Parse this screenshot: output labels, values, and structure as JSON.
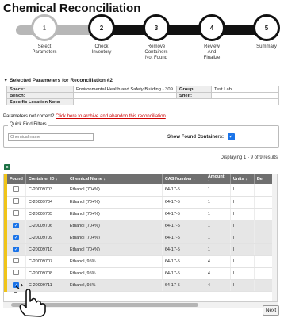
{
  "page_title": "Chemical Reconciliation",
  "steps": [
    {
      "num": "1",
      "label": "Select\nParameters"
    },
    {
      "num": "2",
      "label": "Check\nInventory"
    },
    {
      "num": "3",
      "label": "Remove\nContainers\nNot Found"
    },
    {
      "num": "4",
      "label": "Review\nAnd\nFinalize"
    },
    {
      "num": "5",
      "label": "Summary"
    }
  ],
  "selected_params_heading": "▼ Selected Parameters for Reconciliation #2",
  "params": {
    "space_label": "Space:",
    "space_value": "Environmental Health and Safety Building - 309",
    "group_label": "Group:",
    "group_value": "Test Lab",
    "bench_label": "Bench:",
    "bench_value": "",
    "shelf_label": "Shelf:",
    "shelf_value": "",
    "note_label": "Specific Location Note:",
    "note_value": ""
  },
  "not_correct_text": "Parameters not correct? ",
  "archive_link": "Click here to archive and abandon this reconciliation",
  "quick_find": {
    "legend": "Quick Find Filters",
    "chemical_placeholder": "Chemical name",
    "show_found_label": "Show Found Containers:",
    "show_found_checked": true
  },
  "displaying": "Displaying 1 - 9 of 9 results",
  "grid": {
    "headers": [
      "Found",
      "Container ID ↕",
      "Chemical Name ↕",
      "CAS Number ↕",
      "Amount ↕",
      "Units ↕",
      "Be"
    ],
    "rows": [
      {
        "found": false,
        "id": "C-20009703",
        "name": "Ethanol (70+%)",
        "cas": "64-17-5",
        "amount": "1",
        "units": "l"
      },
      {
        "found": false,
        "id": "C-20009704",
        "name": "Ethanol (70+%)",
        "cas": "64-17-5",
        "amount": "1",
        "units": "l"
      },
      {
        "found": false,
        "id": "C-20009705",
        "name": "Ethanol (70+%)",
        "cas": "64-17-5",
        "amount": "1",
        "units": "l"
      },
      {
        "found": true,
        "id": "C-20009706",
        "name": "Ethanol (70+%)",
        "cas": "64-17-5",
        "amount": "1",
        "units": "l"
      },
      {
        "found": true,
        "id": "C-20009709",
        "name": "Ethanol (70+%)",
        "cas": "64-17-5",
        "amount": "1",
        "units": "l"
      },
      {
        "found": true,
        "id": "C-20009710",
        "name": "Ethanol (70+%)",
        "cas": "64-17-5",
        "amount": "1",
        "units": "l"
      },
      {
        "found": false,
        "id": "C-20009707",
        "name": "Ethanol, 95%",
        "cas": "64-17-5",
        "amount": "4",
        "units": "l"
      },
      {
        "found": false,
        "id": "C-20009708",
        "name": "Ethanol, 95%",
        "cas": "64-17-5",
        "amount": "4",
        "units": "l"
      },
      {
        "found": true,
        "id": "C-20009711",
        "name": "Ethanol, 95%",
        "cas": "64-17-5",
        "amount": "4",
        "units": "l"
      }
    ]
  },
  "next_label": "Next",
  "colors": {
    "header_gray": "#6f6f6f",
    "found_stripe": "#f0c419",
    "checkbox_blue": "#1a73e8",
    "link_red": "#cc0000"
  }
}
